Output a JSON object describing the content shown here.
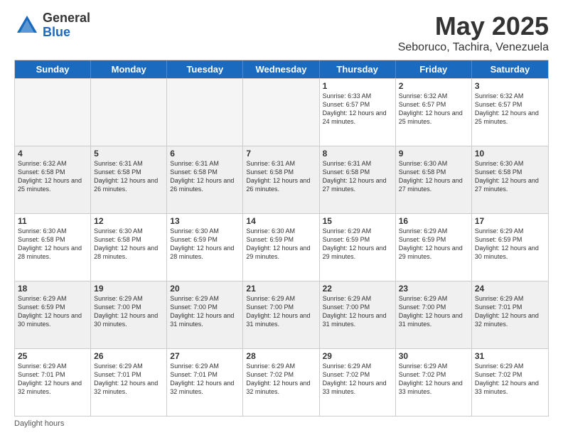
{
  "header": {
    "logo_general": "General",
    "logo_blue": "Blue",
    "main_title": "May 2025",
    "subtitle": "Seboruco, Tachira, Venezuela"
  },
  "weekdays": [
    "Sunday",
    "Monday",
    "Tuesday",
    "Wednesday",
    "Thursday",
    "Friday",
    "Saturday"
  ],
  "rows": [
    [
      {
        "day": "",
        "info": "",
        "empty": true
      },
      {
        "day": "",
        "info": "",
        "empty": true
      },
      {
        "day": "",
        "info": "",
        "empty": true
      },
      {
        "day": "",
        "info": "",
        "empty": true
      },
      {
        "day": "1",
        "info": "Sunrise: 6:33 AM\nSunset: 6:57 PM\nDaylight: 12 hours and 24 minutes.",
        "empty": false
      },
      {
        "day": "2",
        "info": "Sunrise: 6:32 AM\nSunset: 6:57 PM\nDaylight: 12 hours and 25 minutes.",
        "empty": false
      },
      {
        "day": "3",
        "info": "Sunrise: 6:32 AM\nSunset: 6:57 PM\nDaylight: 12 hours and 25 minutes.",
        "empty": false
      }
    ],
    [
      {
        "day": "4",
        "info": "Sunrise: 6:32 AM\nSunset: 6:58 PM\nDaylight: 12 hours and 25 minutes.",
        "empty": false
      },
      {
        "day": "5",
        "info": "Sunrise: 6:31 AM\nSunset: 6:58 PM\nDaylight: 12 hours and 26 minutes.",
        "empty": false
      },
      {
        "day": "6",
        "info": "Sunrise: 6:31 AM\nSunset: 6:58 PM\nDaylight: 12 hours and 26 minutes.",
        "empty": false
      },
      {
        "day": "7",
        "info": "Sunrise: 6:31 AM\nSunset: 6:58 PM\nDaylight: 12 hours and 26 minutes.",
        "empty": false
      },
      {
        "day": "8",
        "info": "Sunrise: 6:31 AM\nSunset: 6:58 PM\nDaylight: 12 hours and 27 minutes.",
        "empty": false
      },
      {
        "day": "9",
        "info": "Sunrise: 6:30 AM\nSunset: 6:58 PM\nDaylight: 12 hours and 27 minutes.",
        "empty": false
      },
      {
        "day": "10",
        "info": "Sunrise: 6:30 AM\nSunset: 6:58 PM\nDaylight: 12 hours and 27 minutes.",
        "empty": false
      }
    ],
    [
      {
        "day": "11",
        "info": "Sunrise: 6:30 AM\nSunset: 6:58 PM\nDaylight: 12 hours and 28 minutes.",
        "empty": false
      },
      {
        "day": "12",
        "info": "Sunrise: 6:30 AM\nSunset: 6:58 PM\nDaylight: 12 hours and 28 minutes.",
        "empty": false
      },
      {
        "day": "13",
        "info": "Sunrise: 6:30 AM\nSunset: 6:59 PM\nDaylight: 12 hours and 28 minutes.",
        "empty": false
      },
      {
        "day": "14",
        "info": "Sunrise: 6:30 AM\nSunset: 6:59 PM\nDaylight: 12 hours and 29 minutes.",
        "empty": false
      },
      {
        "day": "15",
        "info": "Sunrise: 6:29 AM\nSunset: 6:59 PM\nDaylight: 12 hours and 29 minutes.",
        "empty": false
      },
      {
        "day": "16",
        "info": "Sunrise: 6:29 AM\nSunset: 6:59 PM\nDaylight: 12 hours and 29 minutes.",
        "empty": false
      },
      {
        "day": "17",
        "info": "Sunrise: 6:29 AM\nSunset: 6:59 PM\nDaylight: 12 hours and 30 minutes.",
        "empty": false
      }
    ],
    [
      {
        "day": "18",
        "info": "Sunrise: 6:29 AM\nSunset: 6:59 PM\nDaylight: 12 hours and 30 minutes.",
        "empty": false
      },
      {
        "day": "19",
        "info": "Sunrise: 6:29 AM\nSunset: 7:00 PM\nDaylight: 12 hours and 30 minutes.",
        "empty": false
      },
      {
        "day": "20",
        "info": "Sunrise: 6:29 AM\nSunset: 7:00 PM\nDaylight: 12 hours and 31 minutes.",
        "empty": false
      },
      {
        "day": "21",
        "info": "Sunrise: 6:29 AM\nSunset: 7:00 PM\nDaylight: 12 hours and 31 minutes.",
        "empty": false
      },
      {
        "day": "22",
        "info": "Sunrise: 6:29 AM\nSunset: 7:00 PM\nDaylight: 12 hours and 31 minutes.",
        "empty": false
      },
      {
        "day": "23",
        "info": "Sunrise: 6:29 AM\nSunset: 7:00 PM\nDaylight: 12 hours and 31 minutes.",
        "empty": false
      },
      {
        "day": "24",
        "info": "Sunrise: 6:29 AM\nSunset: 7:01 PM\nDaylight: 12 hours and 32 minutes.",
        "empty": false
      }
    ],
    [
      {
        "day": "25",
        "info": "Sunrise: 6:29 AM\nSunset: 7:01 PM\nDaylight: 12 hours and 32 minutes.",
        "empty": false
      },
      {
        "day": "26",
        "info": "Sunrise: 6:29 AM\nSunset: 7:01 PM\nDaylight: 12 hours and 32 minutes.",
        "empty": false
      },
      {
        "day": "27",
        "info": "Sunrise: 6:29 AM\nSunset: 7:01 PM\nDaylight: 12 hours and 32 minutes.",
        "empty": false
      },
      {
        "day": "28",
        "info": "Sunrise: 6:29 AM\nSunset: 7:02 PM\nDaylight: 12 hours and 32 minutes.",
        "empty": false
      },
      {
        "day": "29",
        "info": "Sunrise: 6:29 AM\nSunset: 7:02 PM\nDaylight: 12 hours and 33 minutes.",
        "empty": false
      },
      {
        "day": "30",
        "info": "Sunrise: 6:29 AM\nSunset: 7:02 PM\nDaylight: 12 hours and 33 minutes.",
        "empty": false
      },
      {
        "day": "31",
        "info": "Sunrise: 6:29 AM\nSunset: 7:02 PM\nDaylight: 12 hours and 33 minutes.",
        "empty": false
      }
    ]
  ],
  "footer": "Daylight hours"
}
